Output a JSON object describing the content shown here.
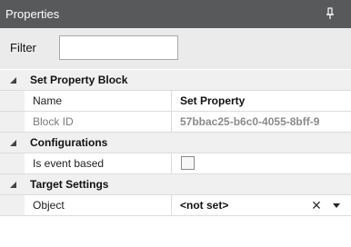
{
  "panel": {
    "title": "Properties"
  },
  "filter": {
    "label": "Filter",
    "value": "",
    "placeholder": ""
  },
  "sections": {
    "set_property_block": {
      "label": "Set Property Block",
      "name_label": "Name",
      "name_value": "Set Property",
      "block_id_label": "Block ID",
      "block_id_value": "57bbac25-b6c0-4055-8bff-9"
    },
    "configurations": {
      "label": "Configurations",
      "event_based_label": "Is event based",
      "event_based_checked": false
    },
    "target_settings": {
      "label": "Target Settings",
      "object_label": "Object",
      "object_value": "<not set>",
      "clear_glyph": "✕"
    }
  },
  "icons": {
    "pin": "pin-icon",
    "collapse": "chevron-down-icon",
    "dropdown": "dropdown-arrow-icon"
  },
  "colors": {
    "titlebar": "#58595b",
    "filterbar": "#ebebeb",
    "category": "#f0f0f0"
  }
}
